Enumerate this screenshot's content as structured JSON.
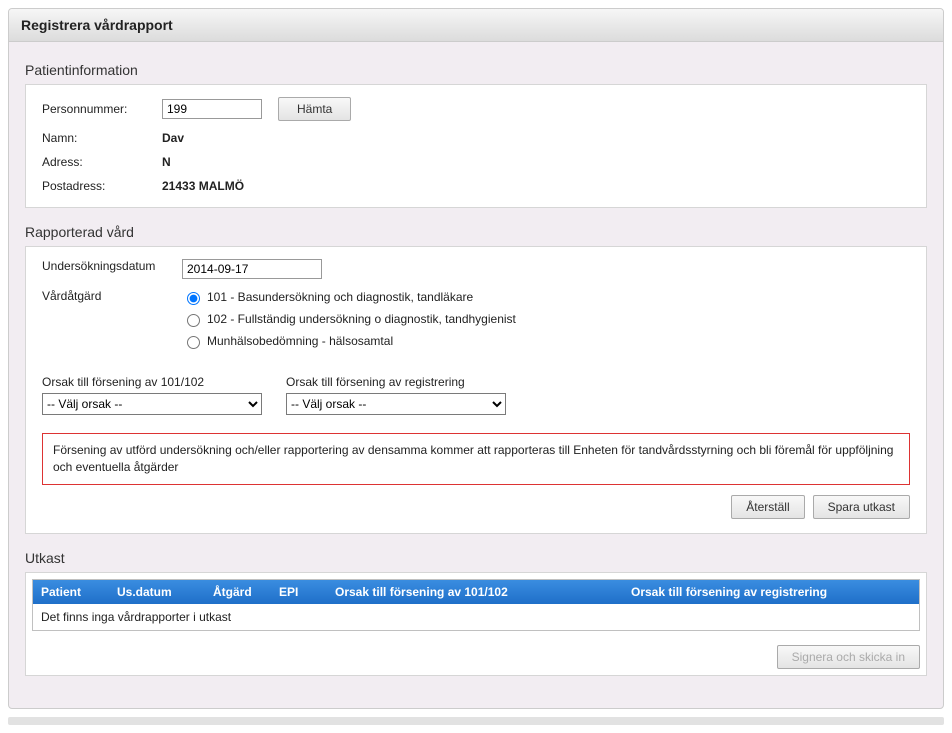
{
  "header": {
    "title": "Registrera vårdrapport"
  },
  "patient": {
    "section_title": "Patientinformation",
    "labels": {
      "personnummer": "Personnummer:",
      "namn": "Namn:",
      "adress": "Adress:",
      "postadress": "Postadress:"
    },
    "values": {
      "personnummer": "199",
      "namn": "Dav",
      "adress": "N",
      "postadress": "21433 MALMÖ"
    },
    "buttons": {
      "hamta": "Hämta"
    }
  },
  "rapport": {
    "section_title": "Rapporterad vård",
    "labels": {
      "datum": "Undersökningsdatum",
      "atgard": "Vårdåtgärd"
    },
    "datum_value": "2014-09-17",
    "radios": [
      {
        "value": "101",
        "label": "101 - Basundersökning och diagnostik, tandläkare",
        "checked": true
      },
      {
        "value": "102",
        "label": "102 - Fullständig undersökning o diagnostik, tandhygienist",
        "checked": false
      },
      {
        "value": "mun",
        "label": "Munhälsobedömning - hälsosamtal",
        "checked": false
      }
    ],
    "selects": {
      "orsak_101102": {
        "label": "Orsak till försening av 101/102",
        "value": "-- Välj orsak --"
      },
      "orsak_reg": {
        "label": "Orsak till försening av registrering",
        "value": "-- Välj orsak --"
      }
    },
    "warning": "Försening av utförd undersökning och/eller rapportering av densamma kommer att rapporteras till Enheten för tandvårdsstyrning och bli föremål för uppföljning och eventuella åtgärder",
    "buttons": {
      "aterstall": "Återställ",
      "spara": "Spara utkast"
    }
  },
  "utkast": {
    "section_title": "Utkast",
    "columns": {
      "patient": "Patient",
      "usdatum": "Us.datum",
      "atgard": "Åtgärd",
      "epi": "EPI",
      "orsak1": "Orsak till försening av 101/102",
      "orsak2": "Orsak till försening av registrering"
    },
    "empty": "Det finns inga vårdrapporter i utkast",
    "buttons": {
      "signera": "Signera och skicka in"
    }
  }
}
